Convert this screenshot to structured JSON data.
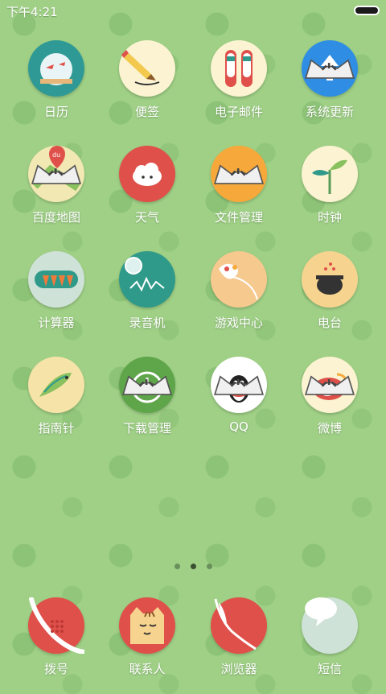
{
  "status": {
    "time": "下午4:21",
    "battery_icon": "battery-icon"
  },
  "apps": [
    {
      "label": "日历",
      "icon": "fishbowl-icon",
      "color": "#2f9a95"
    },
    {
      "label": "便签",
      "icon": "pencil-icon",
      "color": "#fbf3d1"
    },
    {
      "label": "电子邮件",
      "icon": "shoes-icon",
      "color": "#fbf3d1"
    },
    {
      "label": "系统更新",
      "icon": "upload-icon",
      "color": "#2f8ee4"
    },
    {
      "label": "百度地图",
      "icon": "map-pin-icon",
      "color": "#f2e8b3"
    },
    {
      "label": "天气",
      "icon": "cloud-icon",
      "color": "#e0504a"
    },
    {
      "label": "文件管理",
      "icon": "folder-icon",
      "color": "#f6a93a"
    },
    {
      "label": "时钟",
      "icon": "plant-icon",
      "color": "#fbf3d1"
    },
    {
      "label": "计算器",
      "icon": "carrots-icon",
      "color": "#cfe2d8"
    },
    {
      "label": "录音机",
      "icon": "microphone-icon",
      "color": "#2f9a8a"
    },
    {
      "label": "游戏中心",
      "icon": "gamepad-icon",
      "color": "#f6c98f"
    },
    {
      "label": "电台",
      "icon": "pot-icon",
      "color": "#f6d48f"
    },
    {
      "label": "指南针",
      "icon": "fish-icon",
      "color": "#f6e3a8"
    },
    {
      "label": "下载管理",
      "icon": "download-icon",
      "color": "#5fa54a"
    },
    {
      "label": "QQ",
      "icon": "penguin-icon",
      "color": "#ffffff"
    },
    {
      "label": "微博",
      "icon": "weibo-icon",
      "color": "#fbf3d1"
    }
  ],
  "pager": {
    "pages": 3,
    "current": 2
  },
  "dock": [
    {
      "label": "拨号",
      "icon": "phone-icon",
      "color": "#e0504a"
    },
    {
      "label": "联系人",
      "icon": "cat-face-icon",
      "color": "#e0504a"
    },
    {
      "label": "浏览器",
      "icon": "feather-icon",
      "color": "#e0504a"
    },
    {
      "label": "短信",
      "icon": "speech-bubble-icon",
      "color": "#cfe2d8"
    }
  ]
}
